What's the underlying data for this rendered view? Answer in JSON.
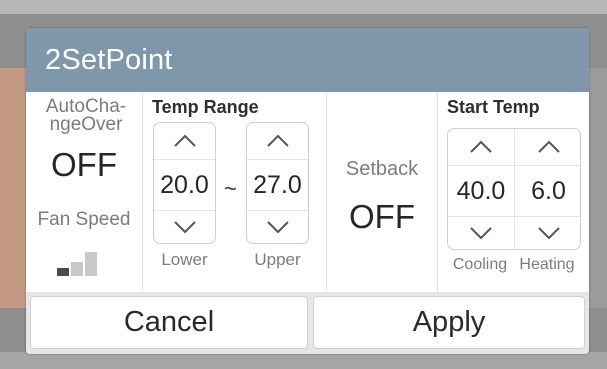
{
  "dialog": {
    "title": "2SetPoint"
  },
  "auto_changeover": {
    "label": "AutoCha-\nngeOver",
    "value": "OFF"
  },
  "fan_speed": {
    "label": "Fan Speed",
    "level": 1,
    "max_level": 3,
    "active_color": "#4a4a4a",
    "inactive_color": "#c8c8c8"
  },
  "temp_range": {
    "header": "Temp Range",
    "separator": "~",
    "lower": {
      "value": "20.0",
      "label": "Lower"
    },
    "upper": {
      "value": "27.0",
      "label": "Upper"
    }
  },
  "setback": {
    "label": "Setback",
    "value": "OFF"
  },
  "start_temp": {
    "header": "Start Temp",
    "cooling": {
      "value": "40.0",
      "label": "Cooling"
    },
    "heating": {
      "value": "6.0",
      "label": "Heating"
    }
  },
  "buttons": {
    "cancel": "Cancel",
    "apply": "Apply"
  },
  "colors": {
    "titlebar": "#7f97ab"
  }
}
